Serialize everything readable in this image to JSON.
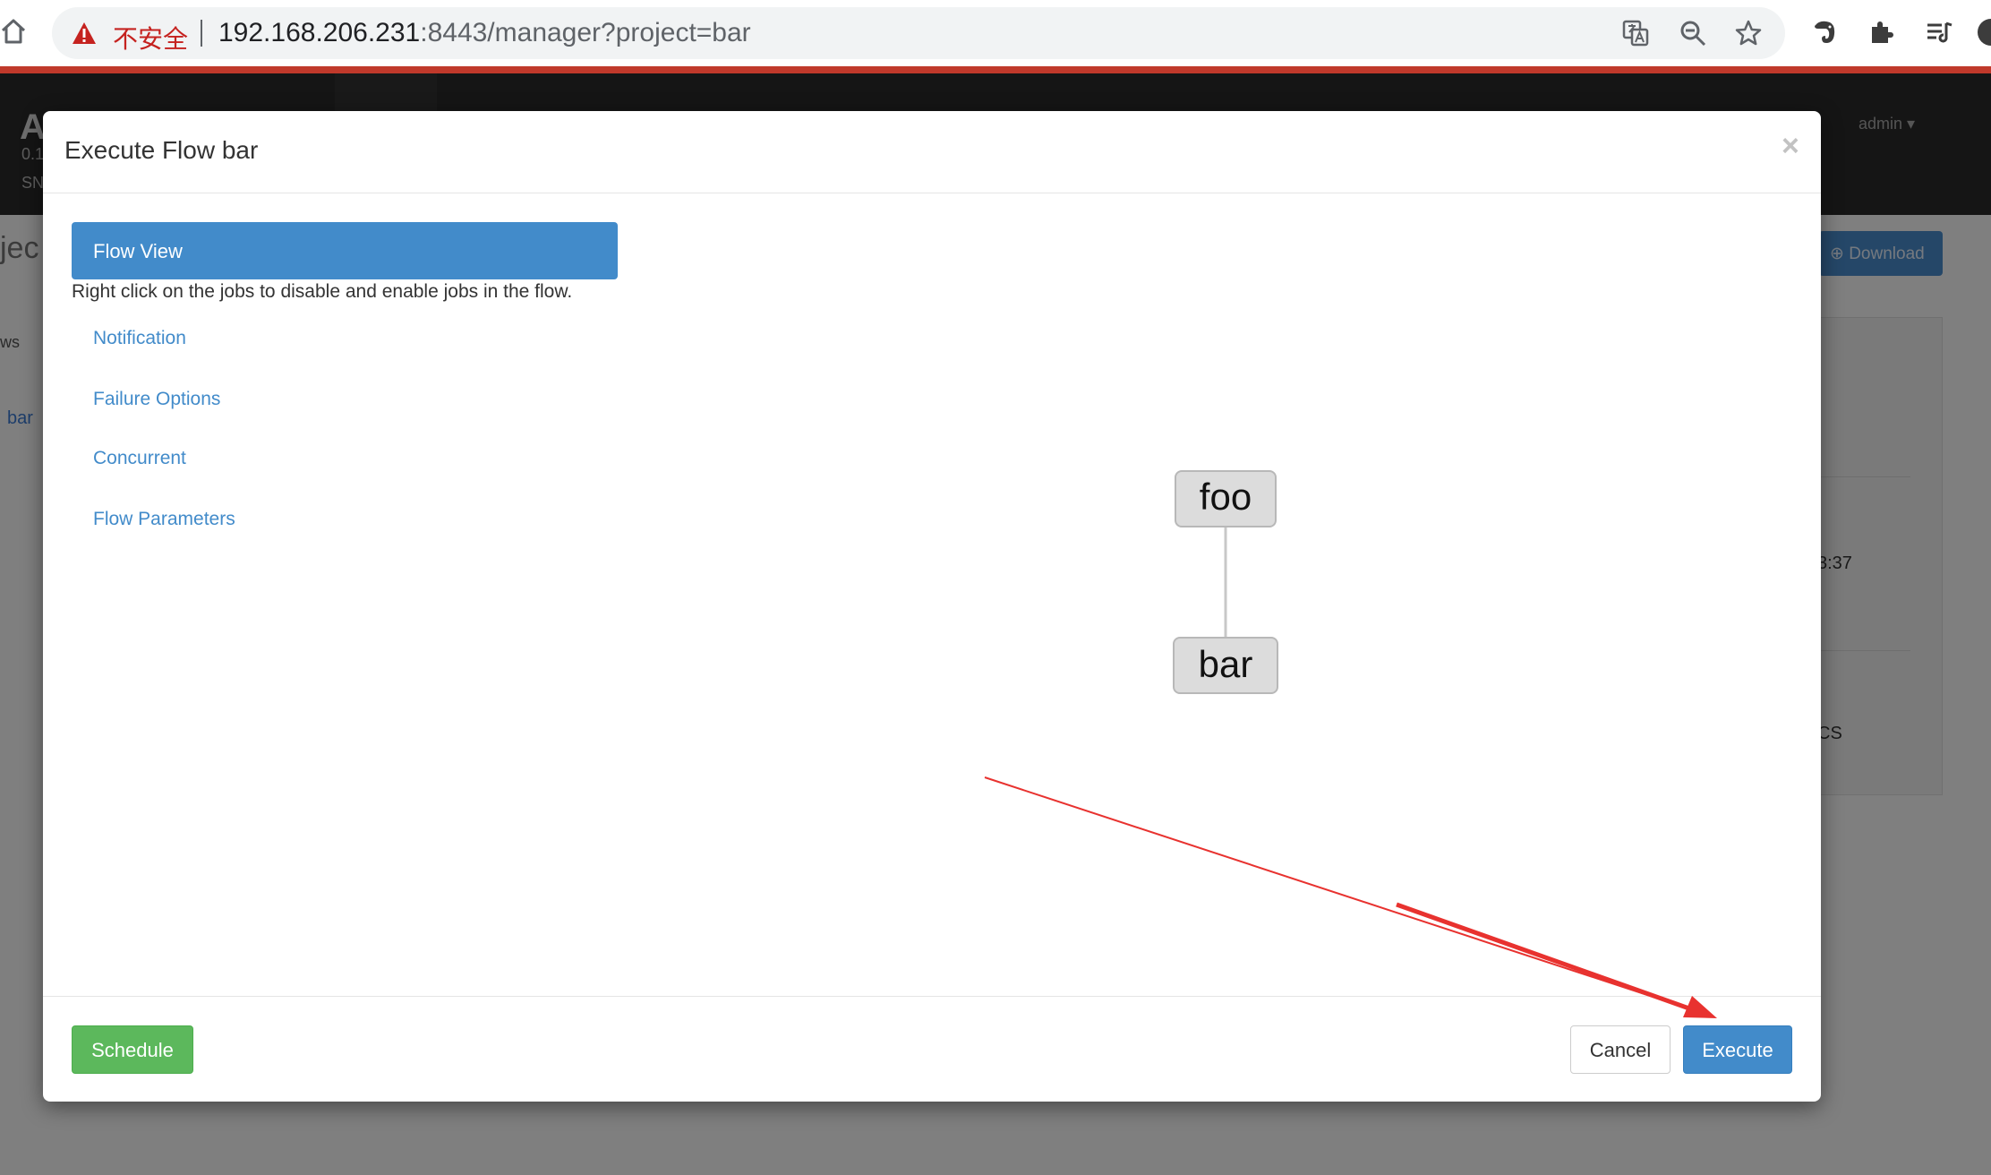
{
  "browser": {
    "insecure_label": "不安全",
    "url_host": "192.168.206.231",
    "url_rest": ":8443/manager?project=bar"
  },
  "background_app": {
    "brand": "A",
    "version_line1": "0.1",
    "version_line2": "SN",
    "user_menu": "admin",
    "page_heading_fragment": "jec",
    "download_label": "Download",
    "left_nav_fragment": "ws",
    "left_flow_link": "bar",
    "time_fragment": "3:37",
    "stats_fragment": "CS"
  },
  "modal": {
    "title": "Execute Flow bar",
    "close_glyph": "×",
    "nav": {
      "active": "Flow View",
      "hint": "Right click on the jobs to disable and enable jobs in the flow.",
      "items": [
        "Notification",
        "Failure Options",
        "Concurrent",
        "Flow Parameters"
      ]
    },
    "graph": {
      "nodes": [
        "foo",
        "bar"
      ]
    },
    "footer": {
      "schedule_label": "Schedule",
      "cancel_label": "Cancel",
      "execute_label": "Execute"
    }
  },
  "colors": {
    "primary": "#428bca",
    "success": "#5cb85c",
    "annotation_arrow": "#e8322f",
    "chrome_accent": "#c0392b"
  }
}
